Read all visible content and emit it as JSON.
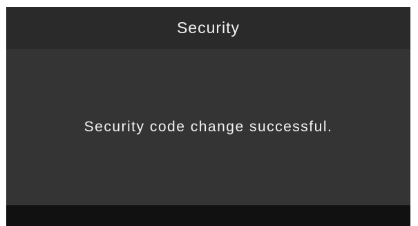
{
  "dialog": {
    "title": "Security",
    "message": "Security code change successful."
  },
  "colors": {
    "title_bar": "#2a2a2a",
    "content_background": "#343434",
    "bottom_bar": "#111111",
    "text": "#f2f2f2"
  }
}
